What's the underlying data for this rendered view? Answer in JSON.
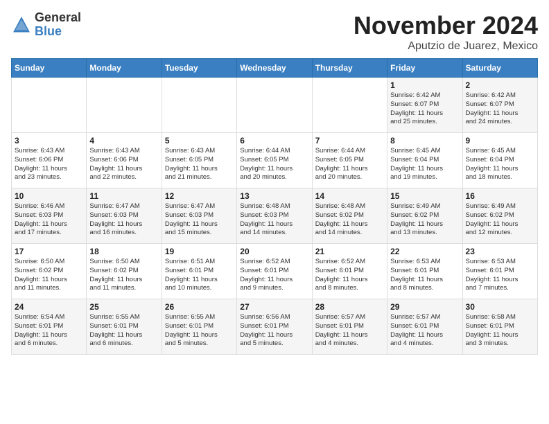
{
  "logo": {
    "general": "General",
    "blue": "Blue"
  },
  "title": "November 2024",
  "location": "Aputzio de Juarez, Mexico",
  "days_of_week": [
    "Sunday",
    "Monday",
    "Tuesday",
    "Wednesday",
    "Thursday",
    "Friday",
    "Saturday"
  ],
  "weeks": [
    [
      {
        "day": "",
        "info": ""
      },
      {
        "day": "",
        "info": ""
      },
      {
        "day": "",
        "info": ""
      },
      {
        "day": "",
        "info": ""
      },
      {
        "day": "",
        "info": ""
      },
      {
        "day": "1",
        "info": "Sunrise: 6:42 AM\nSunset: 6:07 PM\nDaylight: 11 hours\nand 25 minutes."
      },
      {
        "day": "2",
        "info": "Sunrise: 6:42 AM\nSunset: 6:07 PM\nDaylight: 11 hours\nand 24 minutes."
      }
    ],
    [
      {
        "day": "3",
        "info": "Sunrise: 6:43 AM\nSunset: 6:06 PM\nDaylight: 11 hours\nand 23 minutes."
      },
      {
        "day": "4",
        "info": "Sunrise: 6:43 AM\nSunset: 6:06 PM\nDaylight: 11 hours\nand 22 minutes."
      },
      {
        "day": "5",
        "info": "Sunrise: 6:43 AM\nSunset: 6:05 PM\nDaylight: 11 hours\nand 21 minutes."
      },
      {
        "day": "6",
        "info": "Sunrise: 6:44 AM\nSunset: 6:05 PM\nDaylight: 11 hours\nand 20 minutes."
      },
      {
        "day": "7",
        "info": "Sunrise: 6:44 AM\nSunset: 6:05 PM\nDaylight: 11 hours\nand 20 minutes."
      },
      {
        "day": "8",
        "info": "Sunrise: 6:45 AM\nSunset: 6:04 PM\nDaylight: 11 hours\nand 19 minutes."
      },
      {
        "day": "9",
        "info": "Sunrise: 6:45 AM\nSunset: 6:04 PM\nDaylight: 11 hours\nand 18 minutes."
      }
    ],
    [
      {
        "day": "10",
        "info": "Sunrise: 6:46 AM\nSunset: 6:03 PM\nDaylight: 11 hours\nand 17 minutes."
      },
      {
        "day": "11",
        "info": "Sunrise: 6:47 AM\nSunset: 6:03 PM\nDaylight: 11 hours\nand 16 minutes."
      },
      {
        "day": "12",
        "info": "Sunrise: 6:47 AM\nSunset: 6:03 PM\nDaylight: 11 hours\nand 15 minutes."
      },
      {
        "day": "13",
        "info": "Sunrise: 6:48 AM\nSunset: 6:03 PM\nDaylight: 11 hours\nand 14 minutes."
      },
      {
        "day": "14",
        "info": "Sunrise: 6:48 AM\nSunset: 6:02 PM\nDaylight: 11 hours\nand 14 minutes."
      },
      {
        "day": "15",
        "info": "Sunrise: 6:49 AM\nSunset: 6:02 PM\nDaylight: 11 hours\nand 13 minutes."
      },
      {
        "day": "16",
        "info": "Sunrise: 6:49 AM\nSunset: 6:02 PM\nDaylight: 11 hours\nand 12 minutes."
      }
    ],
    [
      {
        "day": "17",
        "info": "Sunrise: 6:50 AM\nSunset: 6:02 PM\nDaylight: 11 hours\nand 11 minutes."
      },
      {
        "day": "18",
        "info": "Sunrise: 6:50 AM\nSunset: 6:02 PM\nDaylight: 11 hours\nand 11 minutes."
      },
      {
        "day": "19",
        "info": "Sunrise: 6:51 AM\nSunset: 6:01 PM\nDaylight: 11 hours\nand 10 minutes."
      },
      {
        "day": "20",
        "info": "Sunrise: 6:52 AM\nSunset: 6:01 PM\nDaylight: 11 hours\nand 9 minutes."
      },
      {
        "day": "21",
        "info": "Sunrise: 6:52 AM\nSunset: 6:01 PM\nDaylight: 11 hours\nand 8 minutes."
      },
      {
        "day": "22",
        "info": "Sunrise: 6:53 AM\nSunset: 6:01 PM\nDaylight: 11 hours\nand 8 minutes."
      },
      {
        "day": "23",
        "info": "Sunrise: 6:53 AM\nSunset: 6:01 PM\nDaylight: 11 hours\nand 7 minutes."
      }
    ],
    [
      {
        "day": "24",
        "info": "Sunrise: 6:54 AM\nSunset: 6:01 PM\nDaylight: 11 hours\nand 6 minutes."
      },
      {
        "day": "25",
        "info": "Sunrise: 6:55 AM\nSunset: 6:01 PM\nDaylight: 11 hours\nand 6 minutes."
      },
      {
        "day": "26",
        "info": "Sunrise: 6:55 AM\nSunset: 6:01 PM\nDaylight: 11 hours\nand 5 minutes."
      },
      {
        "day": "27",
        "info": "Sunrise: 6:56 AM\nSunset: 6:01 PM\nDaylight: 11 hours\nand 5 minutes."
      },
      {
        "day": "28",
        "info": "Sunrise: 6:57 AM\nSunset: 6:01 PM\nDaylight: 11 hours\nand 4 minutes."
      },
      {
        "day": "29",
        "info": "Sunrise: 6:57 AM\nSunset: 6:01 PM\nDaylight: 11 hours\nand 4 minutes."
      },
      {
        "day": "30",
        "info": "Sunrise: 6:58 AM\nSunset: 6:01 PM\nDaylight: 11 hours\nand 3 minutes."
      }
    ]
  ]
}
